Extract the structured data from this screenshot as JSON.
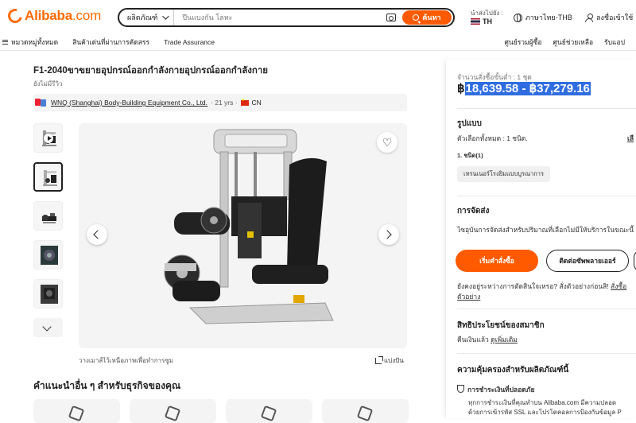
{
  "header": {
    "logo_text": "Alibaba",
    "logo_suffix": ".com",
    "search_category": "ผลิตภัณฑ์",
    "search_placeholder": "ปีนแบงกัน โลหะ",
    "search_button": "ค้นหา",
    "ship_to_label": "นำส่งไปยัง :",
    "ship_to_country": "TH",
    "language_currency": "ภาษาไทย-THB",
    "sign_in": "ลงชื่อเข้าใช้"
  },
  "nav": {
    "left_items": [
      "หมวดหมู่ทั้งหมด",
      "สินค้าเด่นที่ผ่านการคัดสรร",
      "Trade Assurance"
    ],
    "right_items": [
      "ศูนย์รวมผู้ซื้อ",
      "ศูนย์ช่วยเหลือ",
      "รับแอป"
    ]
  },
  "product": {
    "title": "F1-2040ขาขยายอุปกรณ์ออกกำลังกายอุปกรณ์ออกกำลังกาย",
    "reviews": "ยังไม่มีรีวิว",
    "supplier_name": "WNQ (Shanghai) Body-Building Equipment Co., Ltd.",
    "supplier_years": "· 21 yrs ·",
    "supplier_country": "CN",
    "zoom_hint": "วางเมาส์ไว้เหนือภาพเพื่อทำการซูม",
    "share_label": "แบ่งปัน"
  },
  "recommendations": {
    "title": "คำแนะนำอื่น ๆ สำหรับธุรกิจของคุณ"
  },
  "purchase": {
    "min_order": "จำนวนสั่งซื้อขั้นต่ำ : 1 ชุด",
    "price_currency": "฿",
    "price_range": "18,639.58 - ฿37,279.16",
    "variant_heading": "รูปแบบ",
    "variant_selected": "ตัวเลือกทั้งหมด : 1 ชนิด.",
    "variant_select_link": "เลื",
    "variant_type_label": "1. ชนิด(1)",
    "variant_chip": "เทรนเนอร์โรงยิมแบบบูรณาการ",
    "shipping_heading": "การจัดส่ง",
    "shipping_text": "ไซอุบันการจัดส่งสำหรับปริมาณที่เลือกไม่มีให้บริการในขณะนี้",
    "start_order_button": "เริ่มคำสั่งซื้อ",
    "contact_supplier_button": "ติดต่อซัพพลายเออร์",
    "sample_question": "ยังคงอยู่ระหว่างการตัดสินใจเหรอ? สั่งตัวอย่างก่อนสิ!",
    "sample_link": "สั่งซื้อ",
    "sample_link2": "ตัวอย่าง",
    "member_heading": "สิทธิประโยชน์ของสมาชิก",
    "member_text": "คืนเงินแล้ว",
    "member_link": "ดูเพิ่มเติม",
    "protection_heading": "ความคุ้มครองสำหรับผลิตภัณฑ์นี้",
    "secure_payment": "การชำระเงินที่ปลอดภัย",
    "secure_text1": "ทุกการชำระเงินที่คุณทำบน Alibaba.com มีความปลอด",
    "secure_text2": "ด้วยการเข้ารหัส SSL และโปรโตคอลการป้องกันข้อมูล P"
  },
  "colors": {
    "brand": "#ff6a00",
    "primary_button": "#ff5a00",
    "selection_highlight": "#2f6de0"
  }
}
